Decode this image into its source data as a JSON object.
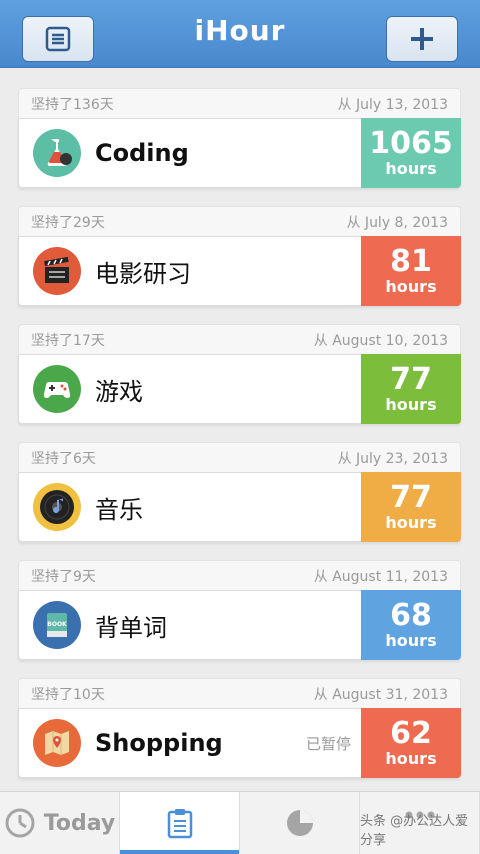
{
  "header": {
    "title": "iHour"
  },
  "items": [
    {
      "since_days": "坚持了136天",
      "from": "从 July 13, 2013",
      "name": "Coding",
      "hours": "1065",
      "unit": "hours",
      "color": "#6ccab0",
      "icon": "flask-icon",
      "icon_bg": "#5cbfa5",
      "bold": true,
      "paused": ""
    },
    {
      "since_days": "坚持了29天",
      "from": "从 July 8, 2013",
      "name": "电影研习",
      "hours": "81",
      "unit": "hours",
      "color": "#ee6a50",
      "icon": "clapperboard-icon",
      "icon_bg": "#e05b3a",
      "bold": false,
      "paused": ""
    },
    {
      "since_days": "坚持了17天",
      "from": "从 August 10, 2013",
      "name": "游戏",
      "hours": "77",
      "unit": "hours",
      "color": "#7cbd3c",
      "icon": "gamepad-icon",
      "icon_bg": "#4aa84a",
      "bold": false,
      "paused": ""
    },
    {
      "since_days": "坚持了6天",
      "from": "从 July 23, 2013",
      "name": "音乐",
      "hours": "77",
      "unit": "hours",
      "color": "#f0ac45",
      "icon": "music-disc-icon",
      "icon_bg": "#f0c040",
      "bold": false,
      "paused": ""
    },
    {
      "since_days": "坚持了9天",
      "from": "从 August 11, 2013",
      "name": "背单词",
      "hours": "68",
      "unit": "hours",
      "color": "#5fa3e0",
      "icon": "book-icon",
      "icon_bg": "#3a6fb0",
      "bold": false,
      "paused": ""
    },
    {
      "since_days": "坚持了10天",
      "from": "从 August 31, 2013",
      "name": "Shopping",
      "hours": "62",
      "unit": "hours",
      "color": "#ee6a50",
      "icon": "map-icon",
      "icon_bg": "#e86a3a",
      "bold": true,
      "paused": "已暂停"
    }
  ],
  "tabs": {
    "today": "Today"
  },
  "watermark": "头条 @办公达人爱分享"
}
